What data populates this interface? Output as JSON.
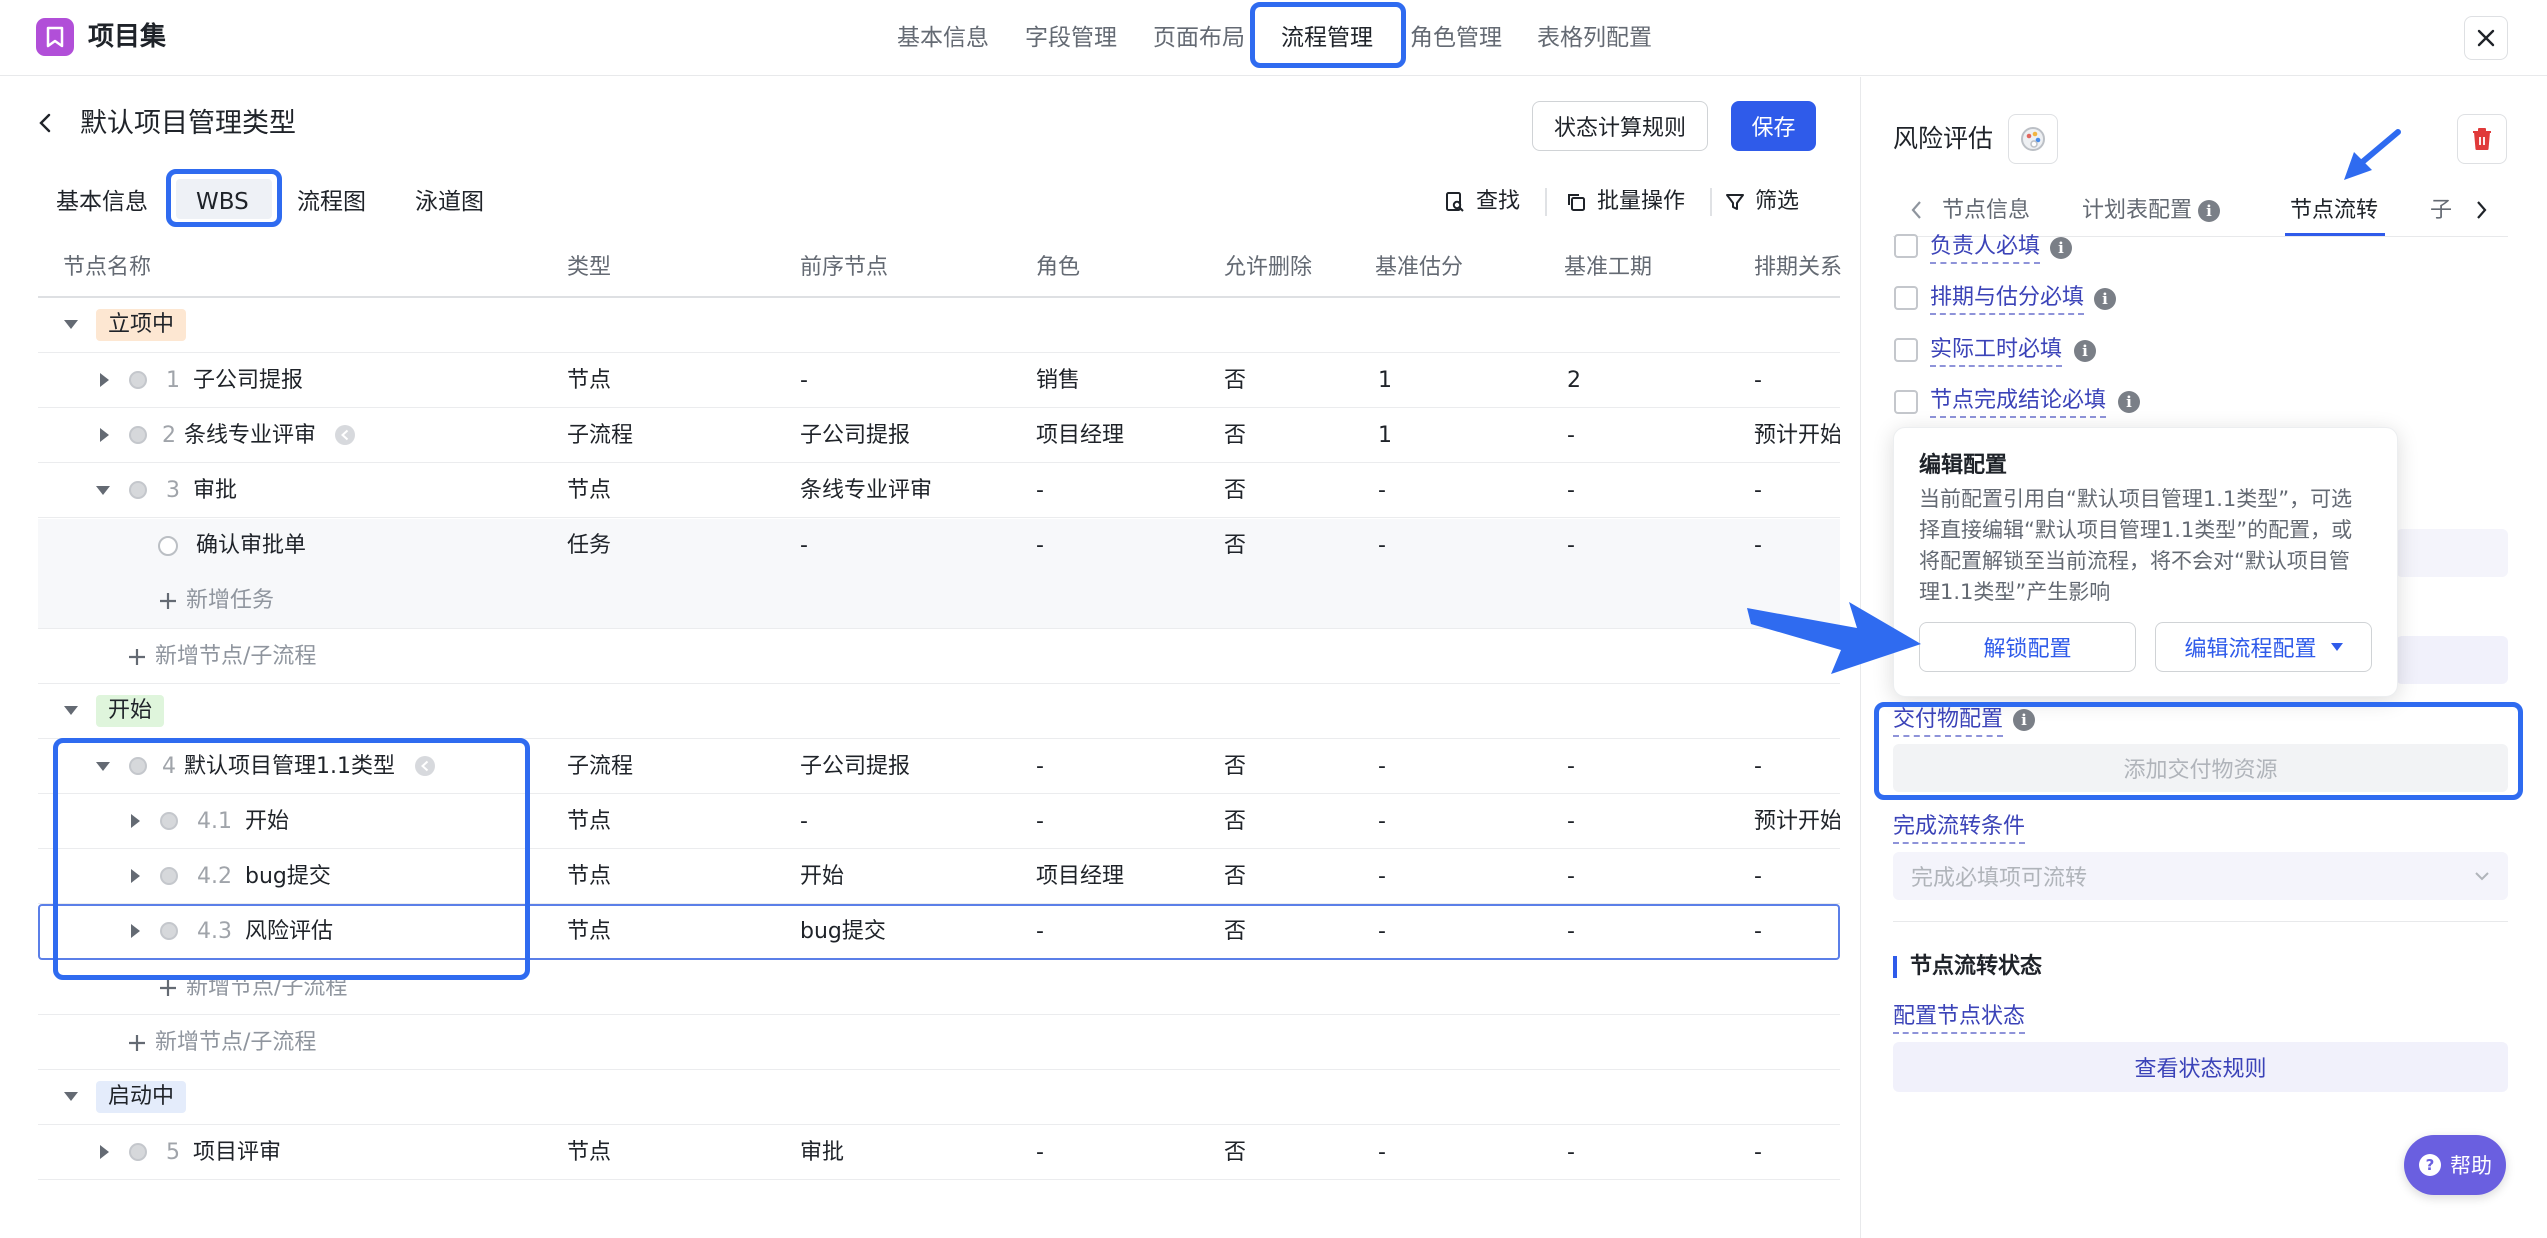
{
  "app": {
    "title": "项目集",
    "close_icon": "close-icon"
  },
  "nav_tabs": [
    "基本信息",
    "字段管理",
    "页面布局",
    "流程管理",
    "角色管理",
    "表格列配置"
  ],
  "page": {
    "title": "默认项目管理类型",
    "state_rule_button": "状态计算规则",
    "save_button": "保存"
  },
  "sub_tabs": [
    "基本信息",
    "WBS",
    "流程图",
    "泳道图"
  ],
  "toolbar": {
    "find": "查找",
    "batch": "批量操作",
    "filter": "筛选"
  },
  "columns": [
    "节点名称",
    "类型",
    "前序节点",
    "角色",
    "允许删除",
    "基准估分",
    "基准工期",
    "排期关系"
  ],
  "groups": {
    "g1": "立项中",
    "g2": "开始",
    "g3": "启动中"
  },
  "rows": [
    {
      "num": "1",
      "name": "子公司提报",
      "type": "节点",
      "prev": "-",
      "role": "销售",
      "del": "否",
      "est": "1",
      "dur": "2",
      "sched": "-"
    },
    {
      "num": "2",
      "name": "条线专业评审",
      "type": "子流程",
      "prev": "子公司提报",
      "role": "项目经理",
      "del": "否",
      "est": "1",
      "dur": "-",
      "sched": "预计开始"
    },
    {
      "num": "3",
      "name": "审批",
      "type": "节点",
      "prev": "条线专业评审",
      "role": "-",
      "del": "否",
      "est": "-",
      "dur": "-",
      "sched": "-"
    },
    {
      "num": "",
      "name": "确认审批单",
      "type": "任务",
      "prev": "-",
      "role": "-",
      "del": "否",
      "est": "-",
      "dur": "-",
      "sched": "-"
    },
    {
      "num": "4",
      "name": "默认项目管理1.1类型",
      "type": "子流程",
      "prev": "子公司提报",
      "role": "-",
      "del": "否",
      "est": "-",
      "dur": "-",
      "sched": "-"
    },
    {
      "num": "4.1",
      "name": "开始",
      "type": "节点",
      "prev": "-",
      "role": "-",
      "del": "否",
      "est": "-",
      "dur": "-",
      "sched": "预计开始"
    },
    {
      "num": "4.2",
      "name": "bug提交",
      "type": "节点",
      "prev": "开始",
      "role": "项目经理",
      "del": "否",
      "est": "-",
      "dur": "-",
      "sched": "-"
    },
    {
      "num": "4.3",
      "name": "风险评估",
      "type": "节点",
      "prev": "bug提交",
      "role": "-",
      "del": "否",
      "est": "-",
      "dur": "-",
      "sched": "-"
    },
    {
      "num": "5",
      "name": "项目评审",
      "type": "节点",
      "prev": "审批",
      "role": "-",
      "del": "否",
      "est": "-",
      "dur": "-",
      "sched": "-"
    }
  ],
  "add": {
    "task": "新增任务",
    "node": "新增节点/子流程"
  },
  "panel": {
    "title": "风险评估",
    "tabs": [
      "节点信息",
      "计划表配置",
      "节点流转",
      "子"
    ],
    "checks": [
      "负责人必填",
      "排期与估分必填",
      "实际工时必填",
      "节点完成结论必填"
    ],
    "popover": {
      "title": "编辑配置",
      "body": "当前配置引用自“默认项目管理1.1类型”，可选择直接编辑“默认项目管理1.1类型”的配置，或将配置解锁至当前流程，将不会对“默认项目管理1.1类型”产生影响",
      "unlock": "解锁配置",
      "edit": "编辑流程配置"
    },
    "deliverable_label": "交付物配置",
    "deliverable_add": "添加交付物资源",
    "complete_label": "完成流转条件",
    "complete_select": "完成必填项可流转",
    "state_section": "节点流转状态",
    "state_link": "配置节点状态",
    "state_button": "查看状态规则"
  },
  "help": "帮助",
  "colors": {
    "primary": "#2f5bea",
    "highlight": "#2f6bf0",
    "tag_orange": "#fde7d2",
    "tag_green": "#dff5dc",
    "tag_blue": "#e4ecfb"
  }
}
